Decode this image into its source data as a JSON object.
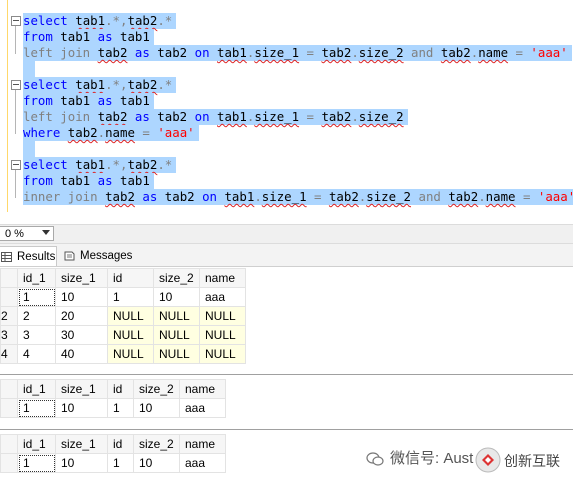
{
  "editor": {
    "blocks": [
      {
        "lines": [
          [
            {
              "t": "select",
              "c": "kw"
            },
            {
              "t": " ",
              "c": "tx"
            },
            {
              "t": "tab1",
              "c": "id"
            },
            {
              "t": ".",
              "c": "gr"
            },
            {
              "t": "*",
              "c": "gr"
            },
            {
              "t": ",",
              "c": "gr"
            },
            {
              "t": "tab2",
              "c": "id"
            },
            {
              "t": ".",
              "c": "gr"
            },
            {
              "t": "*",
              "c": "gr"
            }
          ],
          [
            {
              "t": "from",
              "c": "kw"
            },
            {
              "t": " tab1 ",
              "c": "tx"
            },
            {
              "t": "as",
              "c": "kw"
            },
            {
              "t": " tab1",
              "c": "tx"
            }
          ],
          [
            {
              "t": "left join",
              "c": "gr"
            },
            {
              "t": " ",
              "c": "tx"
            },
            {
              "t": "tab2",
              "c": "id"
            },
            {
              "t": " ",
              "c": "tx"
            },
            {
              "t": "as",
              "c": "kw"
            },
            {
              "t": " tab2 ",
              "c": "tx"
            },
            {
              "t": "on",
              "c": "kw"
            },
            {
              "t": " ",
              "c": "tx"
            },
            {
              "t": "tab1",
              "c": "id"
            },
            {
              "t": ".",
              "c": "gr"
            },
            {
              "t": "size_1",
              "c": "id"
            },
            {
              "t": " = ",
              "c": "gr"
            },
            {
              "t": "tab2",
              "c": "id"
            },
            {
              "t": ".",
              "c": "gr"
            },
            {
              "t": "size_2",
              "c": "id"
            },
            {
              "t": " ",
              "c": "tx"
            },
            {
              "t": "and",
              "c": "gr"
            },
            {
              "t": " ",
              "c": "tx"
            },
            {
              "t": "tab2",
              "c": "id"
            },
            {
              "t": ".",
              "c": "gr"
            },
            {
              "t": "name",
              "c": "id"
            },
            {
              "t": " = ",
              "c": "gr"
            },
            {
              "t": "'aaa'",
              "c": "str"
            }
          ]
        ]
      },
      {
        "lines": [
          [
            {
              "t": "select",
              "c": "kw"
            },
            {
              "t": " ",
              "c": "tx"
            },
            {
              "t": "tab1",
              "c": "id"
            },
            {
              "t": ".",
              "c": "gr"
            },
            {
              "t": "*",
              "c": "gr"
            },
            {
              "t": ",",
              "c": "gr"
            },
            {
              "t": "tab2",
              "c": "id"
            },
            {
              "t": ".",
              "c": "gr"
            },
            {
              "t": "*",
              "c": "gr"
            }
          ],
          [
            {
              "t": "from",
              "c": "kw"
            },
            {
              "t": " tab1 ",
              "c": "tx"
            },
            {
              "t": "as",
              "c": "kw"
            },
            {
              "t": " tab1",
              "c": "tx"
            }
          ],
          [
            {
              "t": "left join",
              "c": "gr"
            },
            {
              "t": " ",
              "c": "tx"
            },
            {
              "t": "tab2",
              "c": "id"
            },
            {
              "t": " ",
              "c": "tx"
            },
            {
              "t": "as",
              "c": "kw"
            },
            {
              "t": " tab2 ",
              "c": "tx"
            },
            {
              "t": "on",
              "c": "kw"
            },
            {
              "t": " ",
              "c": "tx"
            },
            {
              "t": "tab1",
              "c": "id"
            },
            {
              "t": ".",
              "c": "gr"
            },
            {
              "t": "size_1",
              "c": "id"
            },
            {
              "t": " = ",
              "c": "gr"
            },
            {
              "t": "tab2",
              "c": "id"
            },
            {
              "t": ".",
              "c": "gr"
            },
            {
              "t": "size_2",
              "c": "id"
            }
          ],
          [
            {
              "t": "where",
              "c": "kw"
            },
            {
              "t": " ",
              "c": "tx"
            },
            {
              "t": "tab2",
              "c": "id"
            },
            {
              "t": ".",
              "c": "gr"
            },
            {
              "t": "name",
              "c": "id"
            },
            {
              "t": " = ",
              "c": "gr"
            },
            {
              "t": "'aaa'",
              "c": "str"
            }
          ]
        ]
      },
      {
        "lines": [
          [
            {
              "t": "select",
              "c": "kw"
            },
            {
              "t": " ",
              "c": "tx"
            },
            {
              "t": "tab1",
              "c": "id"
            },
            {
              "t": ".",
              "c": "gr"
            },
            {
              "t": "*",
              "c": "gr"
            },
            {
              "t": ",",
              "c": "gr"
            },
            {
              "t": "tab2",
              "c": "id"
            },
            {
              "t": ".",
              "c": "gr"
            },
            {
              "t": "*",
              "c": "gr"
            }
          ],
          [
            {
              "t": "from",
              "c": "kw"
            },
            {
              "t": " tab1 ",
              "c": "tx"
            },
            {
              "t": "as",
              "c": "kw"
            },
            {
              "t": " tab1",
              "c": "tx"
            }
          ],
          [
            {
              "t": "inner join",
              "c": "gr"
            },
            {
              "t": " ",
              "c": "tx"
            },
            {
              "t": "tab2",
              "c": "id"
            },
            {
              "t": " ",
              "c": "tx"
            },
            {
              "t": "as",
              "c": "kw"
            },
            {
              "t": " tab2 ",
              "c": "tx"
            },
            {
              "t": "on",
              "c": "kw"
            },
            {
              "t": " ",
              "c": "tx"
            },
            {
              "t": "tab1",
              "c": "id"
            },
            {
              "t": ".",
              "c": "gr"
            },
            {
              "t": "size_1",
              "c": "id"
            },
            {
              "t": " = ",
              "c": "gr"
            },
            {
              "t": "tab2",
              "c": "id"
            },
            {
              "t": ".",
              "c": "gr"
            },
            {
              "t": "size_2",
              "c": "id"
            },
            {
              "t": " ",
              "c": "tx"
            },
            {
              "t": "and",
              "c": "gr"
            },
            {
              "t": " ",
              "c": "tx"
            },
            {
              "t": "tab2",
              "c": "id"
            },
            {
              "t": ".",
              "c": "gr"
            },
            {
              "t": "name",
              "c": "id"
            },
            {
              "t": " = ",
              "c": "gr"
            },
            {
              "t": "'aaa'",
              "c": "str"
            }
          ]
        ]
      }
    ]
  },
  "zoom": {
    "value": "0 %"
  },
  "tabs": {
    "results": "Results",
    "messages": "Messages"
  },
  "grid1": {
    "columns": [
      "id_1",
      "size_1",
      "id",
      "size_2",
      "name"
    ],
    "rows": [
      {
        "num": "",
        "cells": [
          "1",
          "10",
          "1",
          "10",
          "aaa"
        ]
      },
      {
        "num": "2",
        "cells": [
          "2",
          "20",
          "NULL",
          "NULL",
          "NULL"
        ]
      },
      {
        "num": "3",
        "cells": [
          "3",
          "30",
          "NULL",
          "NULL",
          "NULL"
        ]
      },
      {
        "num": "4",
        "cells": [
          "4",
          "40",
          "NULL",
          "NULL",
          "NULL"
        ]
      }
    ]
  },
  "grid2": {
    "columns": [
      "id_1",
      "size_1",
      "id",
      "size_2",
      "name"
    ],
    "rows": [
      {
        "num": "",
        "cells": [
          "1",
          "10",
          "1",
          "10",
          "aaa"
        ]
      }
    ]
  },
  "grid3": {
    "columns": [
      "id_1",
      "size_1",
      "id",
      "size_2",
      "name"
    ],
    "rows": [
      {
        "num": "",
        "cells": [
          "1",
          "10",
          "1",
          "10",
          "aaa"
        ]
      }
    ]
  },
  "watermark": {
    "text": "微信号: Aust"
  },
  "logo": {
    "text": "创新互联"
  },
  "colors": {
    "selection": "#add6ff",
    "keyword": "#0000ff",
    "string": "#ff0000",
    "null_cell": "#ffffe1"
  }
}
